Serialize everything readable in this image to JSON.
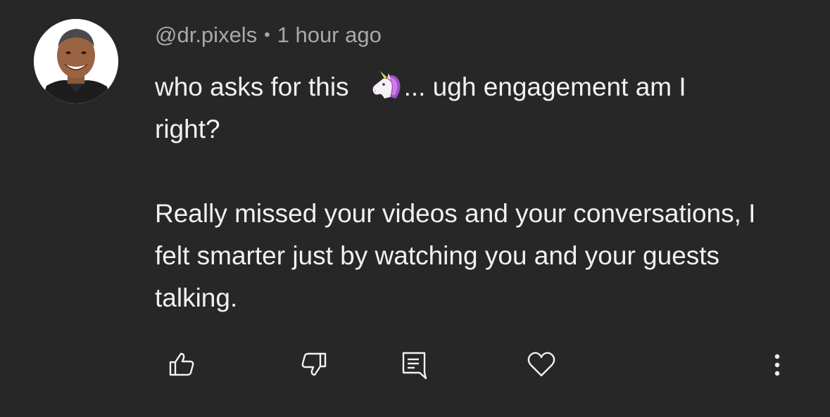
{
  "comment": {
    "author": "@dr.pixels",
    "separator": "•",
    "time": "1 hour ago",
    "text_line1_before": "who asks for this",
    "emoji": "unicorn-emoji",
    "text_line1_after": "... ugh engagement am I",
    "text_line2": "right?",
    "text_paragraph2": "Really missed your videos and your conversations, I felt smarter just by watching you and your guests talking."
  },
  "actions": {
    "icons": [
      "thumbs-up-icon",
      "thumbs-down-icon",
      "reply-icon",
      "heart-icon",
      "more-icon"
    ]
  },
  "colors": {
    "background": "#272727",
    "text": "#f1f1f1",
    "meta": "#a9a9a9",
    "icon": "#f1f1f1"
  }
}
